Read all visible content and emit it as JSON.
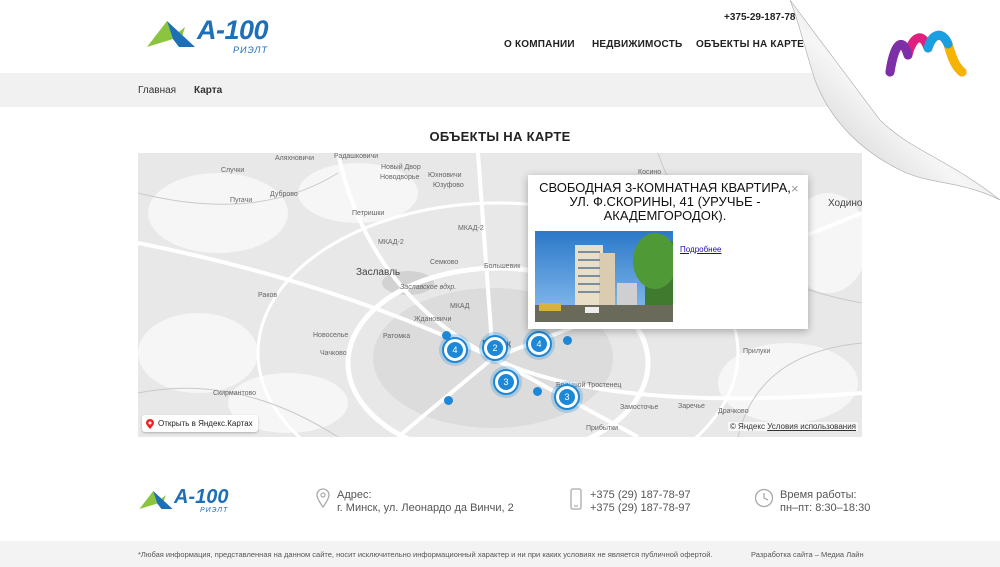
{
  "header": {
    "logo_text": "А-100",
    "logo_sub": "РИЭЛТ",
    "phone": "+375-29-187-78",
    "nav": [
      "О КОМПАНИИ",
      "НЕДВИЖИМОСТЬ",
      "ОБЪЕКТЫ НА КАРТЕ"
    ]
  },
  "breadcrumb": {
    "home": "Главная",
    "current": "Карта"
  },
  "page_title": "ОБЪЕКТЫ НА КАРТЕ",
  "map": {
    "labels": {
      "aliaksh": "Аляхновичи",
      "radash": "Радашковичи",
      "novydvor": "Новый Двор",
      "kosino": "Косино",
      "sluchki": "Случки",
      "novodvor2": "Новодворье",
      "pugachi": "Пугачи",
      "dubrovo": "Дуброво",
      "yukhn": "Юхновичи",
      "yuzufovo": "Юзуфово",
      "petrishki": "Петришки",
      "mkad2a": "МКАД-2",
      "mkad2b": "МКАД-2",
      "semkovo": "Семково",
      "bolshevik": "Большевик",
      "zaslavl": "Заславль",
      "zaslavskoe": "Заславское вдхр.",
      "mkad": "МКАД",
      "rakov": "Раков",
      "novoselye": "Новоселье",
      "ratomka": "Ратомка",
      "zhdanovichi": "Ждановичи",
      "minsk": "Минск",
      "chachkovo": "Чачково",
      "skirmantovo": "Скирмантово",
      "bolshoy": "Большой Тростенец",
      "zamostochye": "Замосточье",
      "prib": "Прибытки",
      "khodin": "Ходино",
      "druchkovo": "Драчково",
      "zarechye": "Заречье",
      "priluky": "Прилуки"
    },
    "clusters": [
      "4",
      "2",
      "4",
      "3",
      "3"
    ],
    "open_yandex": "Открыть в Яндекс.Картах",
    "copyright": "© Яндекс",
    "terms": "Условия использования"
  },
  "popup": {
    "title": "СВОБОДНАЯ 3-КОМНАТНАЯ КВАРТИРА, УЛ. Ф.СКОРИНЫ, 41 (УРУЧЬЕ - АКАДЕМГОРОДОК).",
    "close": "×",
    "more": "Подробнее"
  },
  "footer": {
    "logo_text": "А-100",
    "logo_sub": "РИЭЛТ",
    "address_label": "Адрес:",
    "address": "г. Минск, ул. Леонардо да Винчи, 2",
    "phone1": "+375 (29) 187-78-97",
    "phone2": "+375 (29) 187-78-97",
    "hours_label": "Время работы:",
    "hours": "пн–пт: 8:30–18:30",
    "disclaimer": "*Любая информация, представленная на данном сайте, носит исключительно информационный характер и ни при каких условиях не является публичной офертой.",
    "developer": "Разработка сайта – Медиа Лайн"
  },
  "colors": {
    "brand": "#1d6fb8",
    "green": "#8bc53f",
    "cluster": "#1e88d8"
  }
}
